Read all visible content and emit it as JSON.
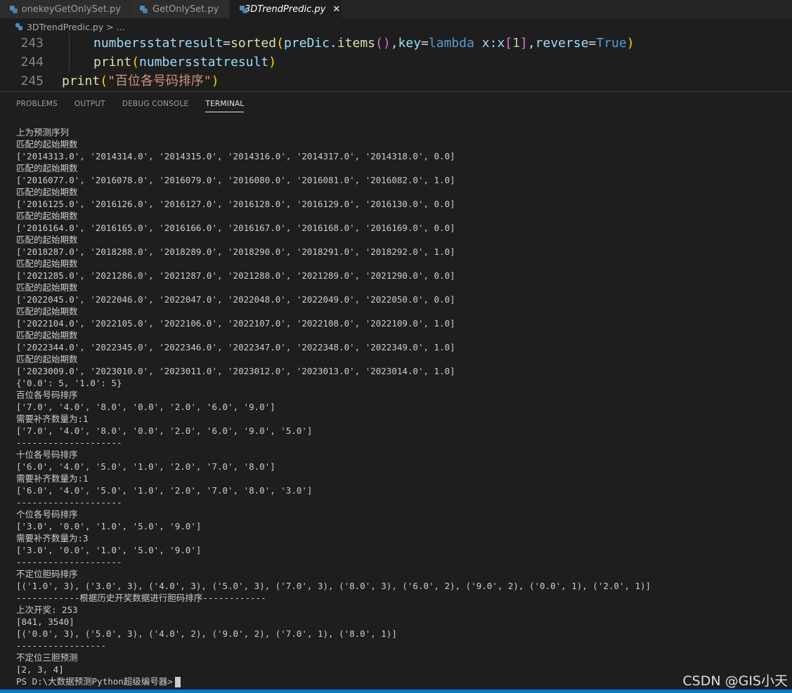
{
  "tabs": [
    {
      "label": "onekeyGetOnlySet.py"
    },
    {
      "label": "GetOnlySet.py"
    },
    {
      "label": "3DTrendPredic.py",
      "close": "✕"
    }
  ],
  "breadcrumb": {
    "file": "3DTrendPredic.py",
    "sep": ">",
    "rest": "..."
  },
  "editor": {
    "lines": [
      {
        "num": "243",
        "tokens": [
          "numbersstatresult",
          "=",
          "sorted",
          "(",
          "preDic",
          ".",
          "items",
          "()",
          ",",
          "key",
          "=",
          "lambda",
          " x:x",
          "[",
          "1",
          "]",
          ",",
          "reverse",
          "=",
          "True",
          ")"
        ]
      },
      {
        "num": "244",
        "tokens": [
          "print",
          "(",
          "numbersstatresult",
          ")"
        ]
      },
      {
        "num": "245",
        "tokens": [
          "print",
          "(",
          "\"百位各号码排序\"",
          ")"
        ]
      }
    ]
  },
  "panel": {
    "tabs": [
      "PROBLEMS",
      "OUTPUT",
      "DEBUG CONSOLE",
      "TERMINAL"
    ],
    "active": "TERMINAL"
  },
  "terminal": {
    "lines": [
      "上为预测序列",
      "匹配的起始期数",
      "['2014313.0', '2014314.0', '2014315.0', '2014316.0', '2014317.0', '2014318.0', 0.0]",
      "匹配的起始期数",
      "['2016077.0', '2016078.0', '2016079.0', '2016080.0', '2016081.0', '2016082.0', 1.0]",
      "匹配的起始期数",
      "['2016125.0', '2016126.0', '2016127.0', '2016128.0', '2016129.0', '2016130.0', 0.0]",
      "匹配的起始期数",
      "['2016164.0', '2016165.0', '2016166.0', '2016167.0', '2016168.0', '2016169.0', 0.0]",
      "匹配的起始期数",
      "['2018287.0', '2018288.0', '2018289.0', '2018290.0', '2018291.0', '2018292.0', 1.0]",
      "匹配的起始期数",
      "['2021285.0', '2021286.0', '2021287.0', '2021288.0', '2021289.0', '2021290.0', 0.0]",
      "匹配的起始期数",
      "['2022045.0', '2022046.0', '2022047.0', '2022048.0', '2022049.0', '2022050.0', 0.0]",
      "匹配的起始期数",
      "['2022104.0', '2022105.0', '2022106.0', '2022107.0', '2022108.0', '2022109.0', 1.0]",
      "匹配的起始期数",
      "['2022344.0', '2022345.0', '2022346.0', '2022347.0', '2022348.0', '2022349.0', 1.0]",
      "匹配的起始期数",
      "['2023009.0', '2023010.0', '2023011.0', '2023012.0', '2023013.0', '2023014.0', 1.0]",
      "{'0.0': 5, '1.0': 5}",
      "百位各号码排序",
      "['7.0', '4.0', '8.0', '0.0', '2.0', '6.0', '9.0']",
      "需要补齐数量为:1",
      "['7.0', '4.0', '8.0', '0.0', '2.0', '6.0', '9.0', '5.0']",
      "--------------------",
      "十位各号码排序",
      "['6.0', '4.0', '5.0', '1.0', '2.0', '7.0', '8.0']",
      "需要补齐数量为:1",
      "['6.0', '4.0', '5.0', '1.0', '2.0', '7.0', '8.0', '3.0']",
      "--------------------",
      "个位各号码排序",
      "['3.0', '0.0', '1.0', '5.0', '9.0']",
      "需要补齐数量为:3",
      "['3.0', '0.0', '1.0', '5.0', '9.0']",
      "--------------------",
      "不定位胆码排序",
      "[('1.0', 3), ('3.0', 3), ('4.0', 3), ('5.0', 3), ('7.0', 3), ('8.0', 3), ('6.0', 2), ('9.0', 2), ('0.0', 1), ('2.0', 1)]",
      "------------根据历史开奖数据进行胆码排序------------",
      "上次开奖: 253",
      "[841, 3540]",
      "[('0.0', 3), ('5.0', 3), ('4.0', 2), ('9.0', 2), ('7.0', 1), ('8.0', 1)]",
      "-----------------",
      "不定位三胆预测",
      "[2, 3, 4]"
    ],
    "prompt": "PS D:\\大数据预测Python超级编号器>"
  },
  "watermark": "CSDN @GIS小天",
  "colors": {
    "background": "#1e1e1e",
    "accent": "#007acc"
  }
}
